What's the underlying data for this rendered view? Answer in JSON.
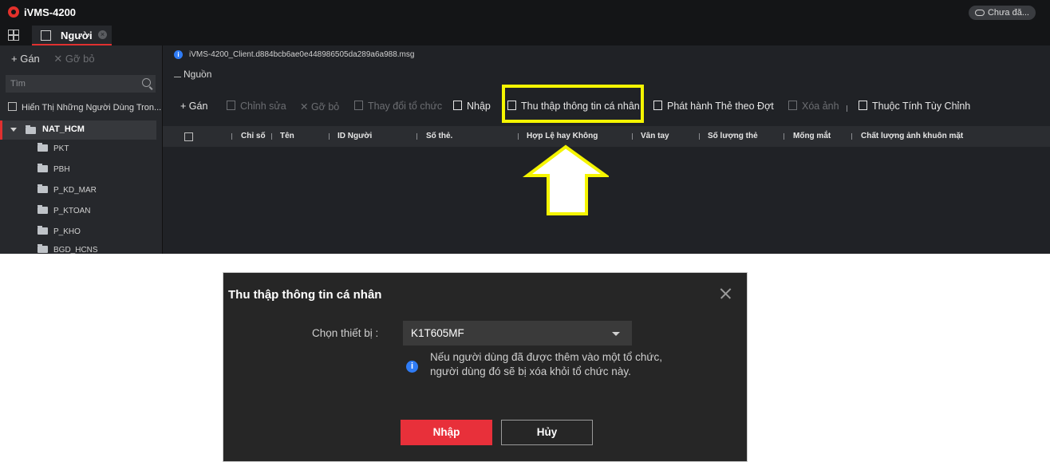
{
  "app": {
    "title": "iVMS-4200",
    "cloud_status": "Chưa đă...",
    "tab_label": "Người"
  },
  "sidebar": {
    "add_label": "+ Gán",
    "remove_label": "✕ Gỡ bỏ",
    "search_placeholder": "Tìm",
    "show_checkbox_label": "Hiển Thị Những Người Dùng Tron...",
    "root": "NAT_HCM",
    "children": [
      "PKT",
      "PBH",
      "P_KD_MAR",
      "P_KTOAN",
      "P_KHO",
      "BGD_HCNS"
    ]
  },
  "main": {
    "file_name": "iVMS-4200_Client.d884bcb6ae0e448986505da289a6a988.msg",
    "source_label": "Nguồn",
    "toolbar": {
      "assign": "+ Gán",
      "edit": "Chỉnh sửa",
      "remove": "Gỡ bỏ",
      "change_org": "Thay đổi tổ chức",
      "import": "Nhập",
      "collect": "Thu thập thông tin cá nhân",
      "issue_cards": "Phát hành Thẻ theo Đợt",
      "delete_photo": "Xóa ảnh",
      "custom_attr": "Thuộc Tính Tùy Chỉnh"
    },
    "columns": [
      "Chỉ số",
      "Tên",
      "ID Người",
      "Số thẻ.",
      "Hợp Lệ hay Không",
      "Vân tay",
      "Số lượng thẻ",
      "Mống mắt",
      "Chất lượng ảnh khuôn mặt"
    ]
  },
  "dialog": {
    "title": "Thu thập thông tin cá nhân",
    "device_label": "Chọn thiết bị :",
    "device_value": "K1T605MF",
    "note_line1": "Nếu người dùng đã được thêm vào một tổ chức,",
    "note_line2": "người dùng đó sẽ bị xóa khỏi tổ chức này.",
    "import_button": "Nhập",
    "cancel_button": "Hủy"
  },
  "colors": {
    "accent_red": "#e8303a",
    "highlight_yellow": "#f5f500",
    "info_blue": "#2f7cf6"
  }
}
